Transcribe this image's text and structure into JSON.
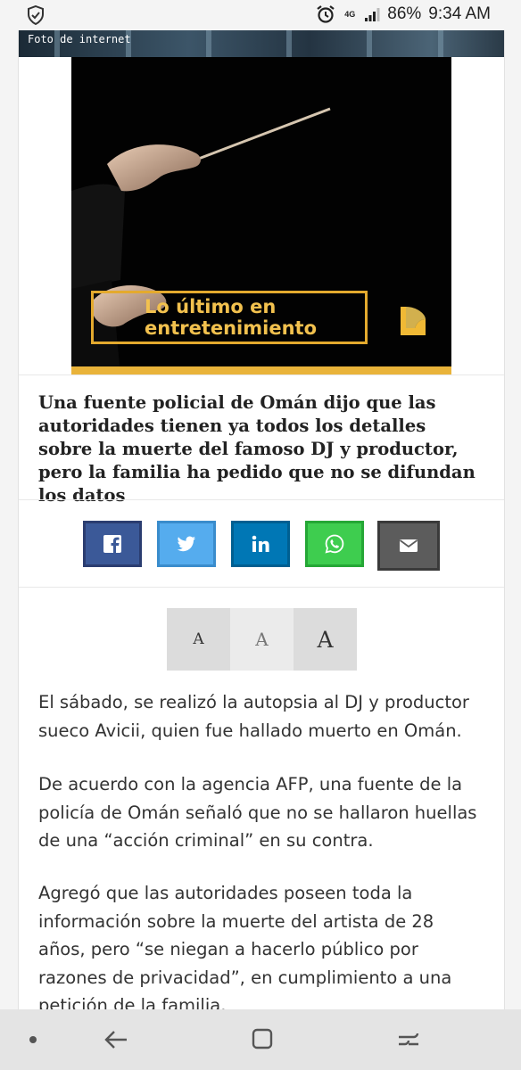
{
  "status_bar": {
    "network": "4G",
    "battery": "86%",
    "time": "9:34 AM"
  },
  "article": {
    "photo_caption": "Foto de internet",
    "promo_text_line1": "Lo último en",
    "promo_text_line2": "entretenimiento",
    "headline": "Una fuente policial de Omán dijo que las autoridades tienen ya todos los detalles sobre la muerte del famoso DJ y productor, pero la familia ha pedido que no se difundan los datos",
    "font_size_labels": [
      "A",
      "A",
      "A"
    ],
    "paragraphs": [
      "El sábado, se realizó la autopsia al DJ y productor sueco Avicii, quien fue hallado muerto en Omán.",
      "De acuerdo con la agencia AFP, una fuente de la policía de Omán señaló que no se hallaron huellas de una “acción criminal” en su contra.",
      "Agregó que las autoridades poseen toda la información sobre la muerte del artista de 28 años, pero “se niegan a hacerlo público por razones de privacidad”, en cumplimiento a una petición de la familia."
    ]
  },
  "share": {
    "buttons": [
      {
        "name": "facebook",
        "icon": "facebook-icon",
        "color": "#3b5998"
      },
      {
        "name": "twitter",
        "icon": "twitter-icon",
        "color": "#55acee"
      },
      {
        "name": "linkedin",
        "icon": "linkedin-icon",
        "color": "#0077b5"
      },
      {
        "name": "whatsapp",
        "icon": "whatsapp-icon",
        "color": "#3ecd4f"
      },
      {
        "name": "email",
        "icon": "mail-icon",
        "color": "#5c5c5c"
      }
    ]
  },
  "colors": {
    "promo_accent": "#e9b33a",
    "promo_text": "#f2c14e"
  }
}
